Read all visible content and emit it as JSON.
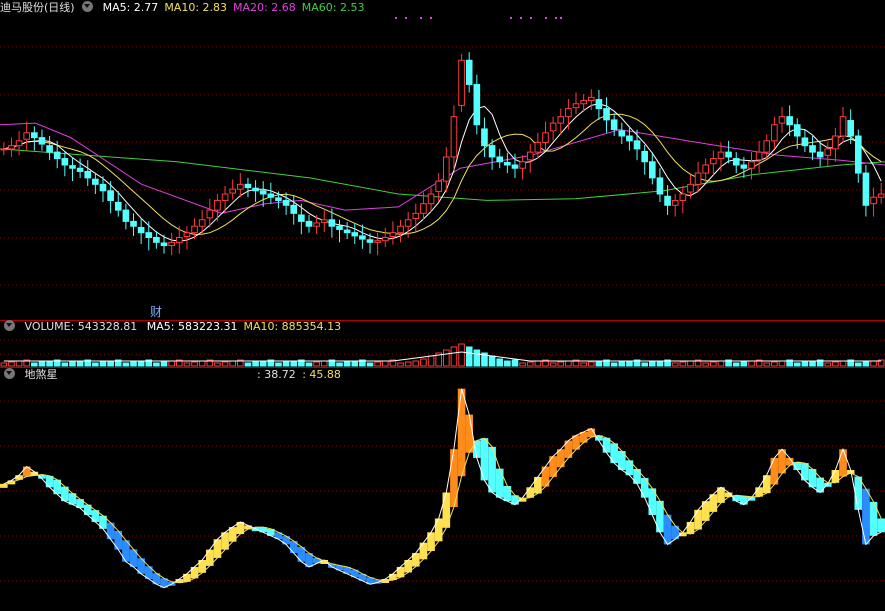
{
  "main": {
    "title": "迪马股份(日线)",
    "ma": [
      {
        "label": "MA5: 2.77",
        "color": "#ffffff"
      },
      {
        "label": "MA10: 2.83",
        "color": "#f0e05a"
      },
      {
        "label": "MA20: 2.68",
        "color": "#e040e0"
      },
      {
        "label": "MA60: 2.53",
        "color": "#40d040"
      }
    ],
    "event_marker": "财"
  },
  "volume": {
    "title": "VOLUME: 543328.81",
    "ma": [
      {
        "label": "MA5: 583223.31",
        "color": "#ffffff"
      },
      {
        "label": "MA10: 885354.13",
        "color": "#f0e05a"
      }
    ]
  },
  "indicator": {
    "title": "地煞星",
    "values_white": ": 38.72",
    "values_yellow": ": 45.88"
  },
  "colors": {
    "up": "#ff3c3c",
    "down": "#54ffff",
    "grid": "#8b0000",
    "border": "#b00000",
    "ma5": "#ffffff",
    "ma10": "#f0e05a",
    "ma20": "#e040e0",
    "ma60": "#40d040"
  },
  "chart_data": {
    "type": "candlestick",
    "ma_key_points": {
      "ma20": [
        [
          0,
          3.05
        ],
        [
          0.04,
          3.06
        ],
        [
          0.08,
          2.97
        ],
        [
          0.16,
          2.68
        ],
        [
          0.25,
          2.5
        ],
        [
          0.3,
          2.56
        ],
        [
          0.34,
          2.58
        ],
        [
          0.39,
          2.52
        ],
        [
          0.45,
          2.54
        ],
        [
          0.52,
          2.78
        ],
        [
          0.6,
          2.86
        ],
        [
          0.7,
          3.02
        ],
        [
          0.8,
          2.93
        ],
        [
          0.88,
          2.86
        ],
        [
          0.95,
          2.83
        ],
        [
          1,
          2.8
        ]
      ],
      "ma60": [
        [
          0,
          2.9
        ],
        [
          0.2,
          2.82
        ],
        [
          0.35,
          2.72
        ],
        [
          0.45,
          2.62
        ],
        [
          0.55,
          2.58
        ],
        [
          0.65,
          2.59
        ],
        [
          0.75,
          2.64
        ],
        [
          0.85,
          2.74
        ],
        [
          0.95,
          2.8
        ],
        [
          1,
          2.82
        ]
      ]
    },
    "closes": [
      2.9,
      2.92,
      2.95,
      3.0,
      2.97,
      2.93,
      2.88,
      2.84,
      2.8,
      2.78,
      2.76,
      2.72,
      2.68,
      2.64,
      2.58,
      2.52,
      2.45,
      2.42,
      2.38,
      2.35,
      2.32,
      2.3,
      2.32,
      2.35,
      2.38,
      2.42,
      2.46,
      2.52,
      2.58,
      2.62,
      2.65,
      2.68,
      2.66,
      2.64,
      2.62,
      2.6,
      2.58,
      2.55,
      2.5,
      2.45,
      2.42,
      2.44,
      2.46,
      2.42,
      2.4,
      2.38,
      2.36,
      2.34,
      2.32,
      2.33,
      2.35,
      2.38,
      2.42,
      2.46,
      2.5,
      2.56,
      2.62,
      2.7,
      2.85,
      3.1,
      3.45,
      3.3,
      3.05,
      2.92,
      2.85,
      2.82,
      2.8,
      2.78,
      2.82,
      2.88,
      2.94,
      3.0,
      3.06,
      3.1,
      3.15,
      3.18,
      3.2,
      3.22,
      3.15,
      3.08,
      3.02,
      2.98,
      2.95,
      2.9,
      2.82,
      2.72,
      2.62,
      2.55,
      2.58,
      2.62,
      2.68,
      2.75,
      2.8,
      2.84,
      2.88,
      2.85,
      2.8,
      2.78,
      2.82,
      2.88,
      2.95,
      3.05,
      3.1,
      3.05,
      2.98,
      2.92,
      2.88,
      2.85,
      2.9,
      2.98,
      3.1,
      2.98,
      2.75,
      2.55,
      2.6,
      2.62
    ],
    "volume_peak_index": 60,
    "indicator": {
      "upper_min": 0,
      "upper_max": 100
    }
  }
}
